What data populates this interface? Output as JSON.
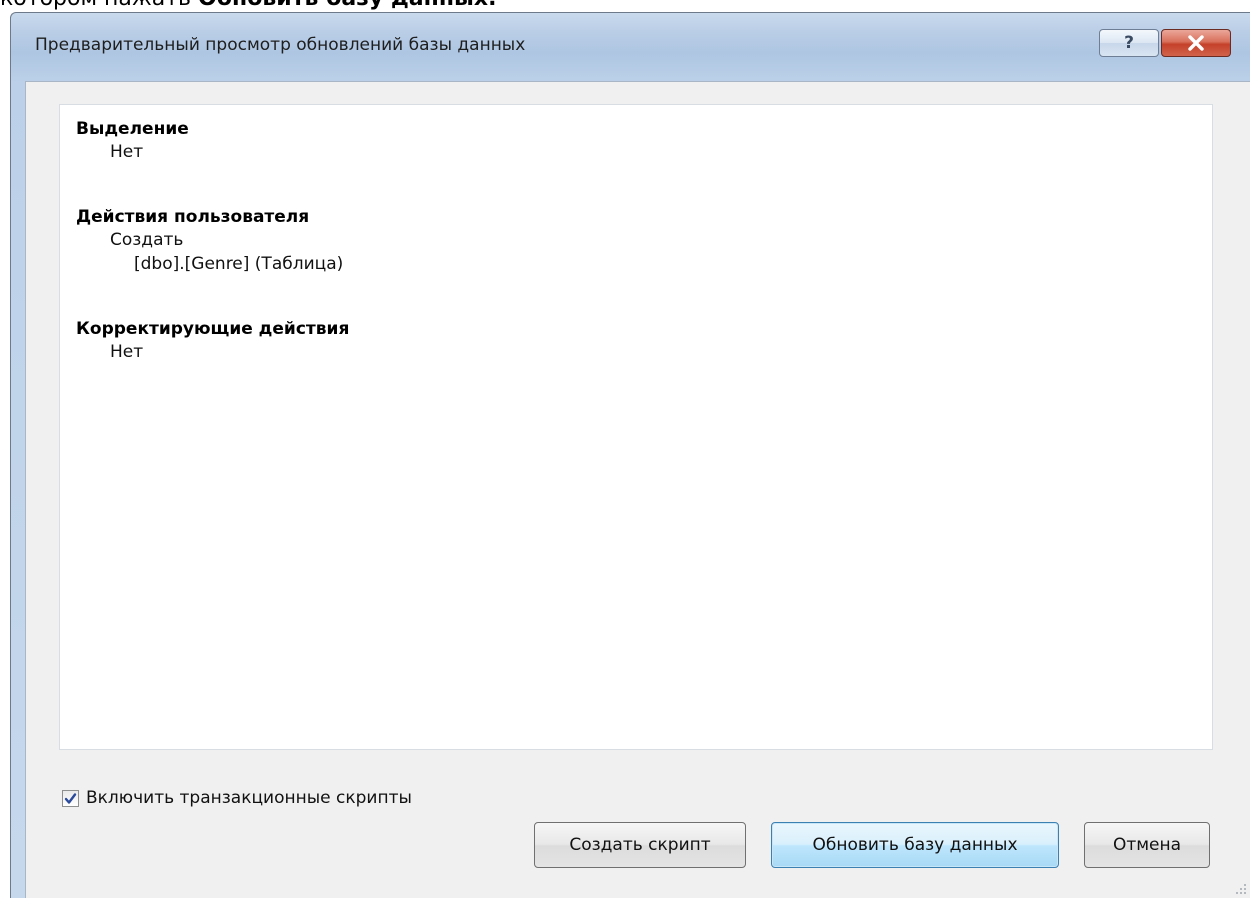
{
  "context_text": {
    "prefix": "котором нажать ",
    "bold": "Обновить базу данных."
  },
  "window": {
    "title": "Предварительный просмотр обновлений базы данных",
    "help_label": "?"
  },
  "preview": {
    "sections": [
      {
        "title": "Выделение",
        "items": [
          "Нет"
        ]
      },
      {
        "title": "Действия пользователя",
        "items": [
          "Создать"
        ],
        "subitems": [
          "[dbo].[Genre] (Таблица)"
        ]
      },
      {
        "title": "Корректирующие действия",
        "items": [
          "Нет"
        ]
      }
    ]
  },
  "options": {
    "include_transactional_scripts_label": "Включить транзакционные скрипты",
    "include_transactional_scripts_checked": true
  },
  "buttons": {
    "create_script": "Создать скрипт",
    "update_database": "Обновить базу данных",
    "cancel": "Отмена"
  },
  "colors": {
    "accent_blue": "#3c7fb1",
    "close_red": "#c5412a"
  }
}
